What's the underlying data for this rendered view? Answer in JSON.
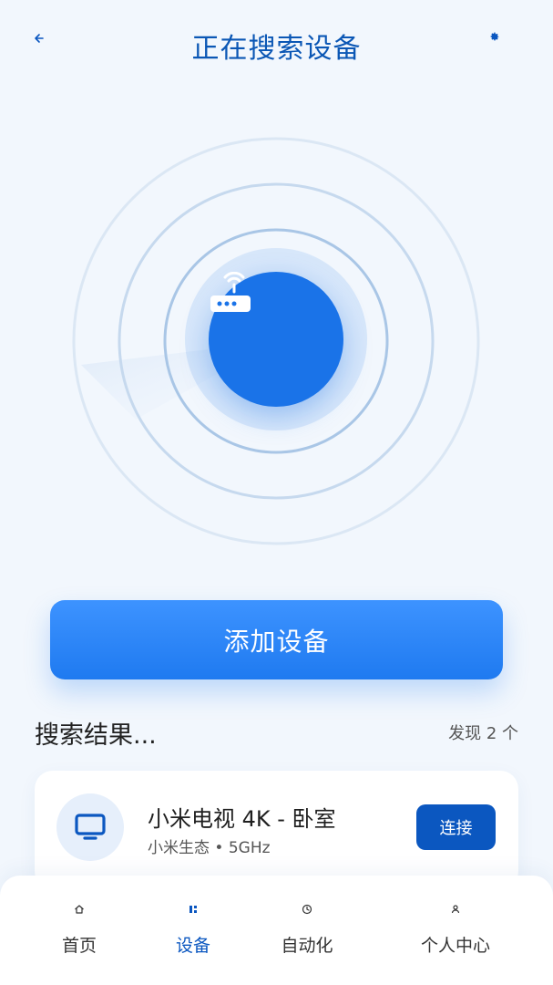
{
  "header": {
    "title": "正在搜索设备",
    "back_icon": "arrow-left-icon",
    "settings_icon": "gear-icon"
  },
  "scanner": {
    "center_icon": "router-wifi-icon"
  },
  "actions": {
    "add_device_label": "添加设备"
  },
  "results": {
    "title": "搜索结果...",
    "count_text": "发现 2 个",
    "devices": [
      {
        "name": "小米电视 4K - 卧室",
        "meta": "小米生态 • 5GHz",
        "icon": "tv-icon",
        "action_label": "连接"
      }
    ]
  },
  "bottom_nav": {
    "items": [
      {
        "label": "首页",
        "icon": "home-icon",
        "active": false
      },
      {
        "label": "设备",
        "icon": "devices-icon",
        "active": true
      },
      {
        "label": "自动化",
        "icon": "clock-icon",
        "active": false
      },
      {
        "label": "个人中心",
        "icon": "person-icon",
        "active": false
      }
    ]
  },
  "colors": {
    "primary": "#1a73e8",
    "primary_dark": "#0b57c0",
    "background": "#f2f7fd",
    "title": "#0b57b5"
  }
}
